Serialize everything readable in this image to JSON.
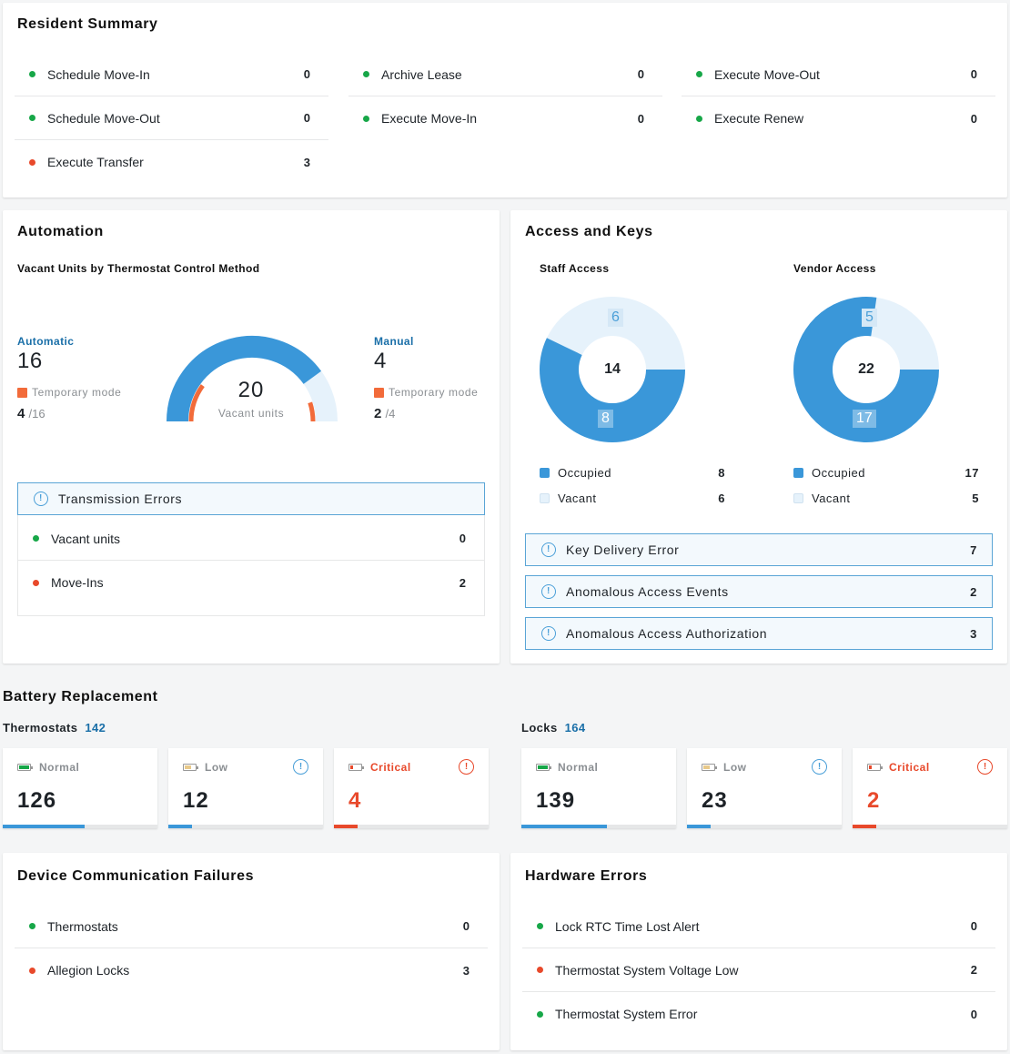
{
  "colors": {
    "green": "#17a748",
    "red": "#e8492b",
    "blue": "#3a97d9",
    "light_blue": "#e6f2fb",
    "orange": "#f26b3a"
  },
  "resident": {
    "title": "Resident Summary",
    "items": [
      {
        "label": "Schedule Move-In",
        "value": "0",
        "status": "green"
      },
      {
        "label": "Schedule Move-Out",
        "value": "0",
        "status": "green"
      },
      {
        "label": "Execute Transfer",
        "value": "3",
        "status": "red"
      },
      {
        "label": "Archive Lease",
        "value": "0",
        "status": "green"
      },
      {
        "label": "Execute Move-In",
        "value": "0",
        "status": "green"
      },
      {
        "label": "Execute Move-Out",
        "value": "0",
        "status": "green"
      },
      {
        "label": "Execute Renew",
        "value": "0",
        "status": "green"
      }
    ]
  },
  "automation": {
    "title": "Automation",
    "subtitle": "Vacant Units by Thermostat Control Method",
    "automatic": {
      "label": "Automatic",
      "count": "16",
      "temp_label": "Temporary mode",
      "temp_value": "4",
      "temp_total": "/16"
    },
    "manual": {
      "label": "Manual",
      "count": "4",
      "temp_label": "Temporary mode",
      "temp_value": "2",
      "temp_total": "/4"
    },
    "gauge": {
      "total": "20",
      "label": "Vacant units",
      "automatic_fraction": 0.8,
      "automatic_temp_fraction": 0.25,
      "manual_temp_fraction": 0.5
    },
    "errors_title": "Transmission Errors",
    "errors": [
      {
        "label": "Vacant units",
        "value": "0",
        "status": "green"
      },
      {
        "label": "Move-Ins",
        "value": "2",
        "status": "red"
      }
    ]
  },
  "access": {
    "title": "Access and Keys",
    "staff": {
      "title": "Staff Access",
      "total": "14",
      "occupied": 8,
      "vacant": 6,
      "occupied_label": "Occupied",
      "vacant_label": "Vacant",
      "occupied_value": "8",
      "vacant_value": "6"
    },
    "vendor": {
      "title": "Vendor Access",
      "total": "22",
      "occupied": 17,
      "vacant": 5,
      "occupied_label": "Occupied",
      "vacant_label": "Vacant",
      "occupied_value": "17",
      "vacant_value": "5"
    },
    "alerts": [
      {
        "label": "Key Delivery Error",
        "value": "7"
      },
      {
        "label": "Anomalous Access Events",
        "value": "2"
      },
      {
        "label": "Anomalous Access Authorization",
        "value": "3"
      }
    ]
  },
  "battery": {
    "title": "Battery Replacement",
    "thermostats": {
      "label": "Thermostats",
      "count": "142",
      "cards": [
        {
          "label": "Normal",
          "value": "126",
          "fraction": 0.53
        },
        {
          "label": "Low",
          "value": "12",
          "fraction": 0.15
        },
        {
          "label": "Critical",
          "value": "4",
          "fraction": 0.15
        }
      ]
    },
    "locks": {
      "label": "Locks",
      "count": "164",
      "cards": [
        {
          "label": "Normal",
          "value": "139",
          "fraction": 0.55
        },
        {
          "label": "Low",
          "value": "23",
          "fraction": 0.15
        },
        {
          "label": "Critical",
          "value": "2",
          "fraction": 0.15
        }
      ]
    }
  },
  "device": {
    "title": "Device Communication Failures",
    "items": [
      {
        "label": "Thermostats",
        "value": "0",
        "status": "green"
      },
      {
        "label": "Allegion Locks",
        "value": "3",
        "status": "red"
      }
    ]
  },
  "hardware": {
    "title": "Hardware Errors",
    "items": [
      {
        "label": "Lock RTC Time Lost Alert",
        "value": "0",
        "status": "green"
      },
      {
        "label": "Thermostat System Voltage Low",
        "value": "2",
        "status": "red"
      },
      {
        "label": "Thermostat System Error",
        "value": "0",
        "status": "green"
      }
    ]
  }
}
